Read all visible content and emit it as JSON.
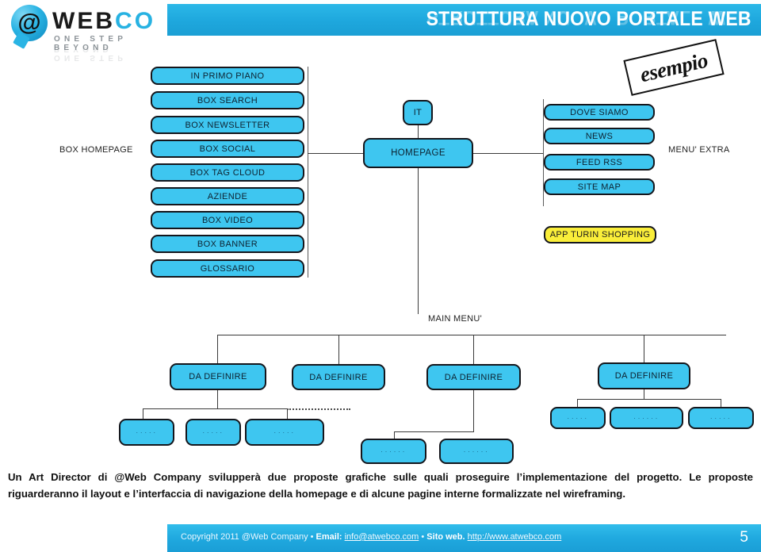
{
  "header": {
    "title": "STRUTTURA NUOVO PORTALE WEB",
    "logo": {
      "at_symbol": "@",
      "word_black_1": "W",
      "word_black_2": "EB",
      "word_blue_1": "C",
      "word_blue_2": "O",
      "tagline": "ONE  STEP  BEYOND"
    },
    "stamp": "esempio"
  },
  "diagram": {
    "left_label": "BOX HOMEPAGE",
    "right_label": "MENU' EXTRA",
    "main_menu_label": "MAIN MENU'",
    "left_boxes": [
      "IN PRIMO PIANO",
      "BOX SEARCH",
      "BOX NEWSLETTER",
      "BOX SOCIAL",
      "BOX TAG CLOUD",
      "AZIENDE",
      "BOX VIDEO",
      "BOX BANNER",
      "GLOSSARIO"
    ],
    "center": {
      "lang": "IT",
      "homepage": "HOMEPAGE"
    },
    "right_boxes": [
      "DOVE SIAMO",
      "NEWS",
      "FEED RSS",
      "SITE MAP"
    ],
    "app_box": "APP TURIN SHOPPING",
    "menu_boxes": [
      "DA DEFINIRE",
      "DA DEFINIRE",
      "DA DEFINIRE",
      "DA DEFINIRE"
    ],
    "leaf_boxes": [
      "·····",
      "·····",
      "·····",
      "······",
      "······",
      "·····",
      "······",
      "·····",
      "······"
    ],
    "colors": {
      "node_fill": "#3ec6f0",
      "node_border": "#14161c",
      "app_fill": "#faee3a",
      "brand": "#27b2e2"
    }
  },
  "body": {
    "paragraph": "Un Art Director di @Web Company svilupperà due proposte grafiche sulle quali proseguire l’implementazione del progetto. Le proposte riguarderanno il layout e l’interfaccia di navigazione della homepage e di alcune pagine interne formalizzate nel wireframing."
  },
  "footer": {
    "copyright": "Copyright 2011 @Web Company • ",
    "email_label": "Email:",
    "email": "info@atwebco.com",
    "sep": " • ",
    "site_label": "Sito web.",
    "site": "http://www.atwebco.com",
    "page_number": "5"
  }
}
